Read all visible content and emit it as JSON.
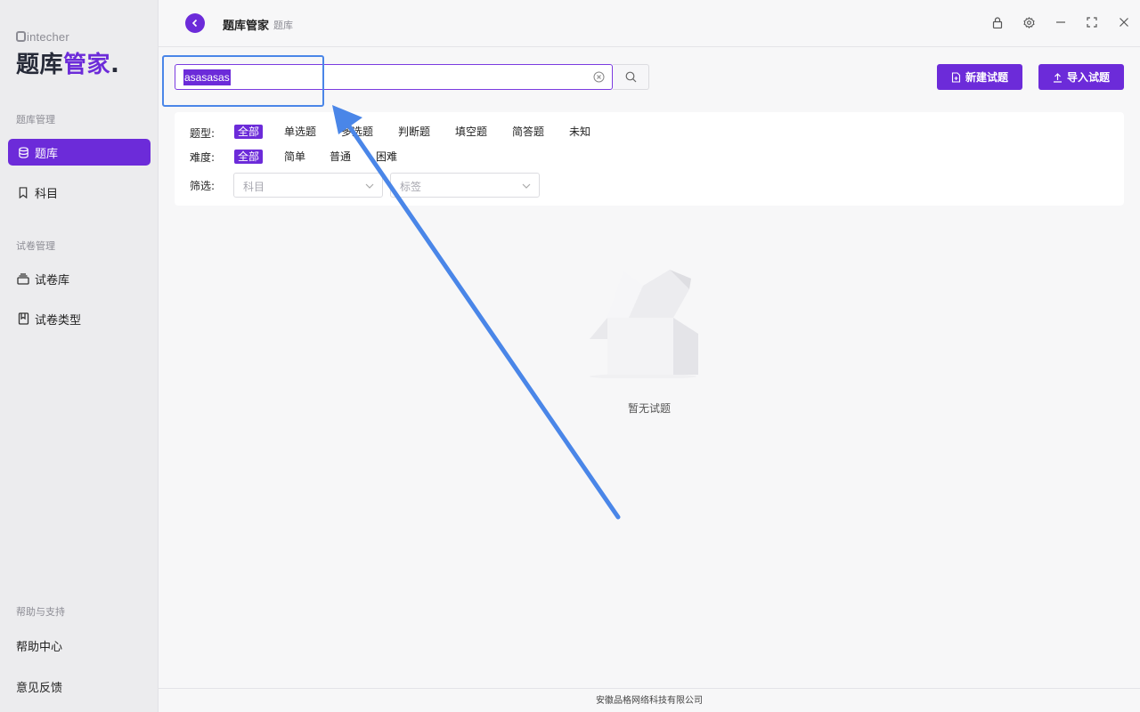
{
  "app": {
    "brand_small": "intecher",
    "brand_big_a": "题库",
    "brand_big_b": "管家",
    "brand_dot": ".",
    "accent_color": "#6c2bd9"
  },
  "sidebar": {
    "section1_label": "题库管理",
    "items1": [
      {
        "label": "题库",
        "icon": "database-icon",
        "active": true
      },
      {
        "label": "科目",
        "icon": "bookmark-icon",
        "active": false
      }
    ],
    "section2_label": "试卷管理",
    "items2": [
      {
        "label": "试卷库",
        "icon": "layers-icon"
      },
      {
        "label": "试卷类型",
        "icon": "book-icon"
      }
    ],
    "section3_label": "帮助与支持",
    "help_center": "帮助中心",
    "feedback": "意见反馈"
  },
  "header": {
    "title": "题库管家",
    "subtitle": "题库"
  },
  "search": {
    "value": "asasasas"
  },
  "toolbar": {
    "new_label": "新建试题",
    "import_label": "导入试题"
  },
  "filters": {
    "type_label": "题型:",
    "type_options": [
      "全部",
      "单选题",
      "多选题",
      "判断题",
      "填空题",
      "简答题",
      "未知"
    ],
    "difficulty_label": "难度:",
    "difficulty_options": [
      "全部",
      "简单",
      "普通",
      "困难"
    ],
    "screen_label": "筛选:",
    "subject_placeholder": "科目",
    "tag_placeholder": "标签"
  },
  "empty": {
    "text": "暂无试题"
  },
  "footer": {
    "text": "安徽品格网络科技有限公司"
  }
}
